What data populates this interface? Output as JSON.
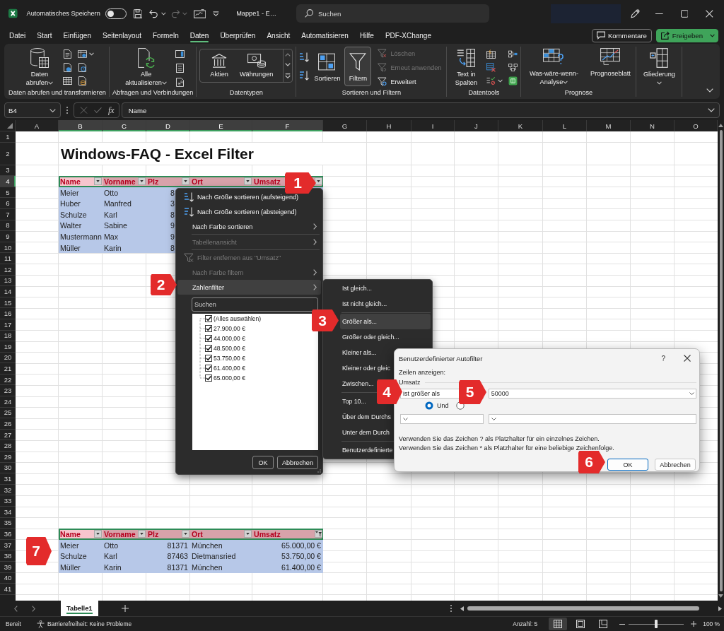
{
  "title_bar": {
    "autosave_label": "Automatisches Speichern",
    "autosave_on": false,
    "file_name": "Mappe1 - E…",
    "search_placeholder": "Suchen"
  },
  "menu_tabs": [
    {
      "label": "Datei",
      "selected": false
    },
    {
      "label": "Start",
      "selected": false
    },
    {
      "label": "Einfügen",
      "selected": false
    },
    {
      "label": "Seitenlayout",
      "selected": false
    },
    {
      "label": "Formeln",
      "selected": false
    },
    {
      "label": "Daten",
      "selected": true
    },
    {
      "label": "Überprüfen",
      "selected": false
    },
    {
      "label": "Ansicht",
      "selected": false
    },
    {
      "label": "Automatisieren",
      "selected": false
    },
    {
      "label": "Hilfe",
      "selected": false
    },
    {
      "label": "PDF-XChange",
      "selected": false
    }
  ],
  "header_buttons": {
    "comments": "Kommentare",
    "share": "Freigeben"
  },
  "ribbon": {
    "groups": [
      {
        "label": "Daten abrufen und transformieren",
        "buttons": [
          {
            "label": "Daten abrufen"
          }
        ]
      },
      {
        "label": "Abfragen und Verbindungen",
        "buttons": [
          {
            "label": "Alle aktualisieren"
          }
        ]
      },
      {
        "label": "Datentypen",
        "buttons": [
          {
            "label": "Aktien"
          },
          {
            "label": "Währungen"
          }
        ]
      },
      {
        "label": "Sortieren und Filtern",
        "buttons": [
          {
            "label": "Sortieren",
            "on": false,
            "disabled": false
          },
          {
            "label": "Filtern",
            "on": true,
            "disabled": false
          },
          {
            "label": "Löschen",
            "on": false,
            "disabled": true
          },
          {
            "label": "Erneut anwenden",
            "on": false,
            "disabled": true
          },
          {
            "label": "Erweitert",
            "on": false,
            "disabled": false
          }
        ]
      },
      {
        "label": "Datentools",
        "buttons": [
          {
            "label": "Text in Spalten"
          }
        ]
      },
      {
        "label": "Prognose",
        "buttons": [
          {
            "label": "Was-wäre-wenn-Analyse"
          },
          {
            "label": "Prognoseblatt"
          }
        ]
      },
      {
        "buttons": [
          {
            "label": "Gliederung"
          }
        ]
      }
    ]
  },
  "formula_bar": {
    "name_box": "B4",
    "function_label": "fx",
    "formula": "Name"
  },
  "sheet": {
    "columns": [
      {
        "label": "A",
        "selected": false
      },
      {
        "label": "B",
        "selected": true
      },
      {
        "label": "C",
        "selected": true
      },
      {
        "label": "D",
        "selected": true
      },
      {
        "label": "E",
        "selected": true
      },
      {
        "label": "F",
        "selected": true
      },
      {
        "label": "G",
        "selected": false
      },
      {
        "label": "H",
        "selected": false
      },
      {
        "label": "I",
        "selected": false
      },
      {
        "label": "J",
        "selected": false
      },
      {
        "label": "K",
        "selected": false
      },
      {
        "label": "L",
        "selected": false
      },
      {
        "label": "M",
        "selected": false
      },
      {
        "label": "N",
        "selected": false
      },
      {
        "label": "O",
        "selected": false
      }
    ],
    "rows": [
      {
        "label": "1",
        "selected": false
      },
      {
        "label": "2",
        "selected": false
      },
      {
        "label": "3",
        "selected": false
      },
      {
        "label": "4",
        "selected": true
      },
      {
        "label": "5",
        "selected": false
      },
      {
        "label": "6",
        "selected": false
      },
      {
        "label": "7",
        "selected": false
      },
      {
        "label": "8",
        "selected": false
      },
      {
        "label": "9",
        "selected": false
      },
      {
        "label": "10",
        "selected": false
      },
      {
        "label": "11",
        "selected": false
      },
      {
        "label": "12",
        "selected": false
      },
      {
        "label": "13",
        "selected": false
      },
      {
        "label": "14",
        "selected": false
      },
      {
        "label": "15",
        "selected": false
      },
      {
        "label": "16",
        "selected": false
      },
      {
        "label": "17",
        "selected": false
      },
      {
        "label": "18",
        "selected": false
      },
      {
        "label": "19",
        "selected": false
      },
      {
        "label": "20",
        "selected": false
      },
      {
        "label": "21",
        "selected": false
      },
      {
        "label": "22",
        "selected": false
      },
      {
        "label": "23",
        "selected": false
      },
      {
        "label": "24",
        "selected": false
      },
      {
        "label": "25",
        "selected": false
      },
      {
        "label": "26",
        "selected": false
      },
      {
        "label": "27",
        "selected": false
      },
      {
        "label": "28",
        "selected": false
      },
      {
        "label": "29",
        "selected": false
      },
      {
        "label": "30",
        "selected": false
      },
      {
        "label": "31",
        "selected": false
      },
      {
        "label": "32",
        "selected": false
      },
      {
        "label": "33",
        "selected": false
      },
      {
        "label": "34",
        "selected": false
      },
      {
        "label": "35",
        "selected": false
      },
      {
        "label": "36",
        "selected": false
      },
      {
        "label": "37",
        "selected": false
      },
      {
        "label": "38",
        "selected": false
      },
      {
        "label": "39",
        "selected": false
      },
      {
        "label": "40",
        "selected": false
      },
      {
        "label": "41",
        "selected": false
      }
    ],
    "title": "Windows-FAQ - Excel Filter",
    "tables": [
      {
        "header_selected": true,
        "headers": [
          {
            "label": "Name",
            "filter_button": true,
            "filter_applied": false
          },
          {
            "label": "Vorname",
            "filter_button": true,
            "filter_applied": false
          },
          {
            "label": "Plz",
            "filter_button": true,
            "filter_applied": false
          },
          {
            "label": "Ort",
            "filter_button": true,
            "filter_applied": false
          },
          {
            "label": "Umsatz",
            "filter_button": true,
            "filter_applied": false
          }
        ],
        "rows": [
          [
            "Meier",
            "Otto",
            "8"
          ],
          [
            "Huber",
            "Manfred",
            "3"
          ],
          [
            "Schulze",
            "Karl",
            "8"
          ],
          [
            "Walter",
            "Sabine",
            "9"
          ],
          [
            "Mustermann",
            "Max",
            "9"
          ],
          [
            "Müller",
            "Karin",
            "8"
          ]
        ]
      },
      {
        "header_selected": true,
        "headers": [
          {
            "label": "Name",
            "filter_button": true,
            "filter_applied": false
          },
          {
            "label": "Vorname",
            "filter_button": true,
            "filter_applied": false
          },
          {
            "label": "Plz",
            "filter_button": true,
            "filter_applied": false
          },
          {
            "label": "Ort",
            "filter_button": true,
            "filter_applied": false
          },
          {
            "label": "Umsatz",
            "filter_button": true,
            "filter_applied": true
          }
        ],
        "rows": [
          [
            "Meier",
            "Otto",
            "81371",
            "München",
            "65.000,00 €"
          ],
          [
            "Schulze",
            "Karl",
            "87463",
            "Dietmansried",
            "53.750,00 €"
          ],
          [
            "Müller",
            "Karin",
            "81371",
            "München",
            "61.400,00 €"
          ]
        ]
      }
    ]
  },
  "filter_menu": {
    "items": [
      {
        "kind": "command",
        "label": "Nach Größe sortieren (aufsteigend)",
        "disabled": false,
        "highlighted": false,
        "submenu": false
      },
      {
        "kind": "command",
        "label": "Nach Größe sortieren (absteigend)",
        "disabled": false,
        "highlighted": false,
        "submenu": false
      },
      {
        "kind": "command",
        "label": "Nach Farbe sortieren",
        "disabled": false,
        "highlighted": false,
        "submenu": true
      },
      {
        "kind": "separator"
      },
      {
        "kind": "command",
        "label": "Tabellenansicht",
        "disabled": true,
        "highlighted": false,
        "submenu": true
      },
      {
        "kind": "separator"
      },
      {
        "kind": "command",
        "label": "Filter entfernen aus \"Umsatz\"",
        "disabled": true,
        "highlighted": false,
        "submenu": false
      },
      {
        "kind": "command",
        "label": "Nach Farbe filtern",
        "disabled": true,
        "highlighted": false,
        "submenu": true
      },
      {
        "kind": "command",
        "label": "Zahlenfilter",
        "disabled": false,
        "highlighted": true,
        "submenu": true
      }
    ],
    "search_placeholder": "Suchen",
    "values": [
      {
        "label": "(Alles auswählen)",
        "checked": true
      },
      {
        "label": "27.900,00 €",
        "checked": true
      },
      {
        "label": "44.000,00 €",
        "checked": true
      },
      {
        "label": "48.500,00 €",
        "checked": true
      },
      {
        "label": "53.750,00 €",
        "checked": true
      },
      {
        "label": "61.400,00 €",
        "checked": true
      },
      {
        "label": "65.000,00 €",
        "checked": true
      }
    ],
    "buttons": [
      "OK",
      "Abbrechen"
    ]
  },
  "number_filter_menu": {
    "items": [
      {
        "kind": "command",
        "label": "Ist gleich...",
        "highlighted": false
      },
      {
        "kind": "command",
        "label": "Ist nicht gleich...",
        "highlighted": false
      },
      {
        "kind": "separator"
      },
      {
        "kind": "command",
        "label": "Größer als...",
        "highlighted": true
      },
      {
        "kind": "command",
        "label": "Größer oder gleich...",
        "highlighted": false
      },
      {
        "kind": "command",
        "label": "Kleiner als...",
        "highlighted": false
      },
      {
        "kind": "command",
        "label": "Kleiner oder gleic",
        "highlighted": false
      },
      {
        "kind": "command",
        "label": "Zwischen...",
        "highlighted": false
      },
      {
        "kind": "separator"
      },
      {
        "kind": "command",
        "label": "Top 10...",
        "highlighted": false
      },
      {
        "kind": "command",
        "label": "Über dem Durchs",
        "highlighted": false
      },
      {
        "kind": "command",
        "label": "Unter dem Durch",
        "highlighted": false
      },
      {
        "kind": "separator"
      },
      {
        "kind": "command",
        "label": "Benutzerdefinierte",
        "highlighted": false
      }
    ]
  },
  "dialog": {
    "title": "Benutzerdefinierter Autofilter",
    "help_label": "?",
    "instruction": "Zeilen anzeigen:",
    "field_label": "Umsatz",
    "conditions": [
      {
        "operator": "ist größer als",
        "value": "50000"
      }
    ],
    "joins": [
      {
        "label": "Und",
        "selected": true
      },
      {
        "selected": false
      }
    ],
    "hints": [
      "Verwenden Sie das Zeichen ? als Platzhalter für ein einzelnes Zeichen.",
      "Verwenden Sie das Zeichen * als Platzhalter für eine beliebige Zeichenfolge."
    ],
    "buttons": [
      {
        "label": "OK",
        "default": true
      },
      {
        "label": "Abbrechen",
        "default": false
      }
    ]
  },
  "callouts": [
    "1",
    "2",
    "3",
    "4",
    "5",
    "6",
    "7"
  ],
  "sheet_tabs": [
    {
      "label": "Tabelle1",
      "selected": true
    }
  ],
  "status_bar": {
    "mode": "Bereit",
    "accessibility": "Barrierefreiheit: Keine Probleme",
    "count": "Anzahl: 5",
    "views": [
      {
        "selected": true
      },
      {
        "selected": false
      },
      {
        "selected": false
      }
    ],
    "zoom_slider": {
      "level": 0.5
    },
    "zoom": "100 %"
  }
}
